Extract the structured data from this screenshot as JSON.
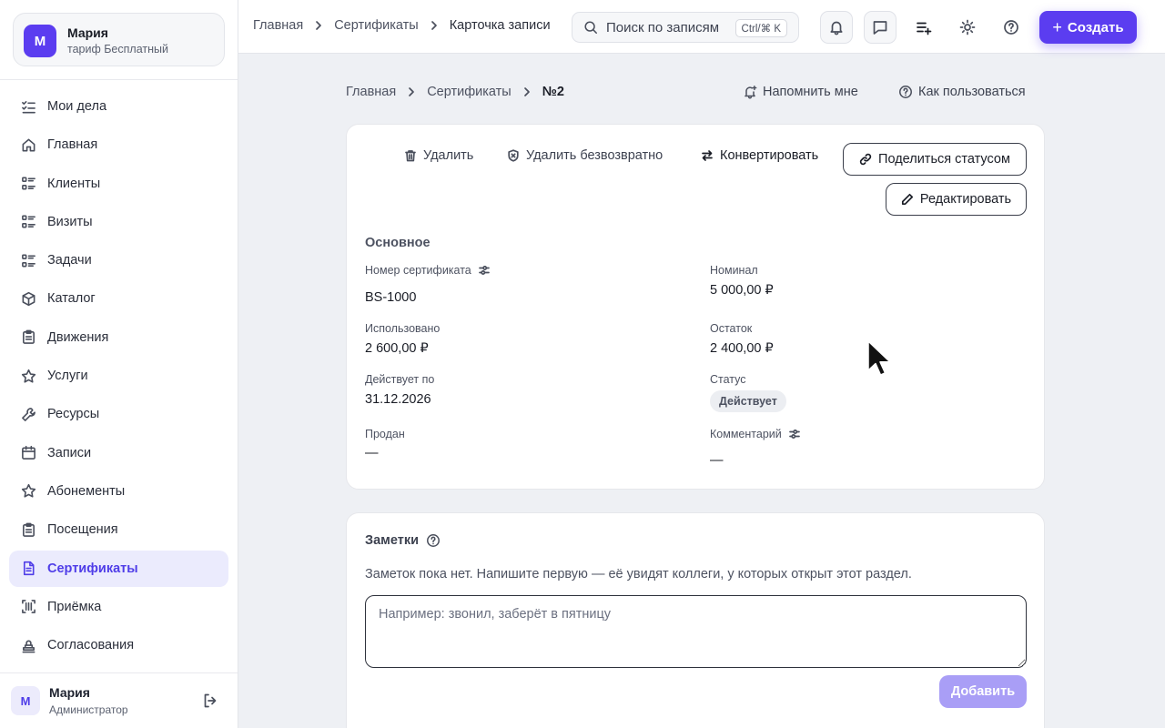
{
  "account": {
    "initial": "М",
    "name": "Мария",
    "plan": "тариф Бесплатный"
  },
  "sidebar": {
    "items": [
      {
        "label": "Мои дела",
        "icon": "list-check-icon"
      },
      {
        "label": "Главная",
        "icon": "home-icon"
      },
      {
        "label": "Клиенты",
        "icon": "list-icon"
      },
      {
        "label": "Визиты",
        "icon": "list-icon"
      },
      {
        "label": "Задачи",
        "icon": "list-icon"
      },
      {
        "label": "Каталог",
        "icon": "box-icon"
      },
      {
        "label": "Движения",
        "icon": "clipboard-icon"
      },
      {
        "label": "Услуги",
        "icon": "star-icon"
      },
      {
        "label": "Ресурсы",
        "icon": "wrench-icon"
      },
      {
        "label": "Записи",
        "icon": "calendar-icon"
      },
      {
        "label": "Абонементы",
        "icon": "star-icon"
      },
      {
        "label": "Посещения",
        "icon": "clipboard-icon"
      },
      {
        "label": "Сертификаты",
        "icon": "document-icon",
        "active": true
      },
      {
        "label": "Приёмка",
        "icon": "barcode-icon"
      },
      {
        "label": "Согласования",
        "icon": "stamp-icon"
      }
    ]
  },
  "user": {
    "initial": "М",
    "name": "Мария",
    "role": "Администратор"
  },
  "topbar": {
    "breadcrumbs": [
      "Главная",
      "Сертификаты",
      "Карточка записи"
    ],
    "search_placeholder": "Поиск по записям",
    "search_shortcut": "Ctrl/⌘ K",
    "create_label": "Создать"
  },
  "page": {
    "breadcrumbs": [
      "Главная",
      "Сертификаты",
      "№2"
    ],
    "remind_label": "Напомнить мне",
    "help_label": "Как пользоваться"
  },
  "actions": {
    "delete": "Удалить",
    "delete_forever": "Удалить безвозвратно",
    "convert": "Конвертировать",
    "share_status": "Поделиться статусом",
    "edit": "Редактировать"
  },
  "record": {
    "section_title": "Основное",
    "fields": {
      "cert_number_label": "Номер сертификата",
      "cert_number": "BS-1000",
      "nominal_label": "Номинал",
      "nominal": "5 000,00 ₽",
      "used_label": "Использовано",
      "used": "2 600,00 ₽",
      "balance_label": "Остаток",
      "balance": "2 400,00 ₽",
      "valid_until_label": "Действует по",
      "valid_until": "31.12.2026",
      "status_label": "Статус",
      "status": "Действует",
      "sold_label": "Продан",
      "sold": "—",
      "comment_label": "Комментарий",
      "comment": "—"
    }
  },
  "notes": {
    "title": "Заметки",
    "empty_text": "Заметок пока нет. Напишите первую — её увидят коллеги, у которых открыт этот раздел.",
    "placeholder": "Например: звонил, заберёт в пятницу",
    "add_label": "Добавить"
  },
  "colors": {
    "accent": "#5b3df0",
    "accent_soft": "#ebebfd",
    "add_disabled": "#a99ef6"
  }
}
